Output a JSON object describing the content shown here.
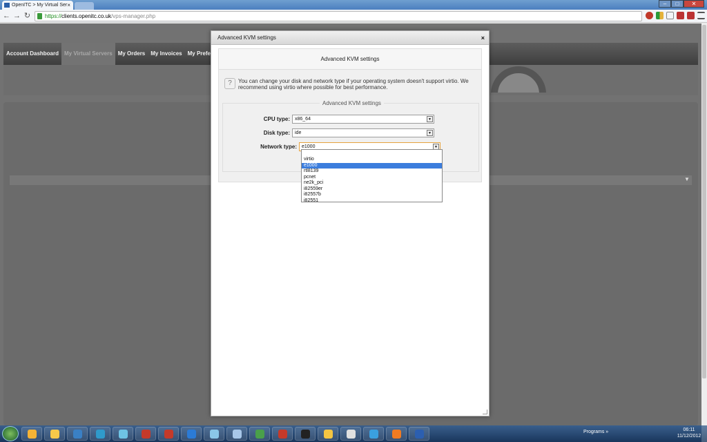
{
  "browser": {
    "tab_title": "OpenITC > My Virtual Ser",
    "tab_close": "×",
    "url_scheme": "https://",
    "url_host": "clients.openitc.co.uk",
    "url_path": "/vps-manager.php",
    "window_controls": [
      "‒",
      "□",
      "✕"
    ]
  },
  "nav": {
    "items": [
      "Account Dashboard",
      "My Virtual Servers",
      "My Orders",
      "My Invoices",
      "My Prefe"
    ],
    "active_index": 1
  },
  "modal": {
    "title": "Advanced KVM settings",
    "close": "×",
    "panel_heading": "Advanced KVM settings",
    "info": "You can change your disk and network type if your operating system doesn't support virtio. We recommend using virtio where possible for best performance.",
    "legend": "Advanced KVM settings",
    "cpu": {
      "label": "CPU type:",
      "value": "x86_64"
    },
    "disk": {
      "label": "Disk type:",
      "value": "ide"
    },
    "network": {
      "label": "Network type:",
      "value": "e1000",
      "options": [
        "virtio",
        "e1000",
        "rtl8139",
        "pcnet",
        "ne2k_pci",
        "i82559er",
        "i82557b",
        "i82551"
      ],
      "highlighted": "e1000"
    }
  },
  "taskbar": {
    "programs": "Programs",
    "programs_chevron": "»",
    "time": "06:11",
    "date": "11/12/2012",
    "icon_colors": [
      "#f5b335",
      "#f6c94a",
      "#3a80c5",
      "#2f9acb",
      "#6ec3e4",
      "#c53a2a",
      "#c53a2a",
      "#2b7bd6",
      "#8bc7e8",
      "#a7c6e8",
      "#4aa04a",
      "#c53a2a",
      "#222222",
      "#f4c542",
      "#e0e0e0",
      "#3aa0e0",
      "#f07b22",
      "#2c5fb0"
    ]
  }
}
